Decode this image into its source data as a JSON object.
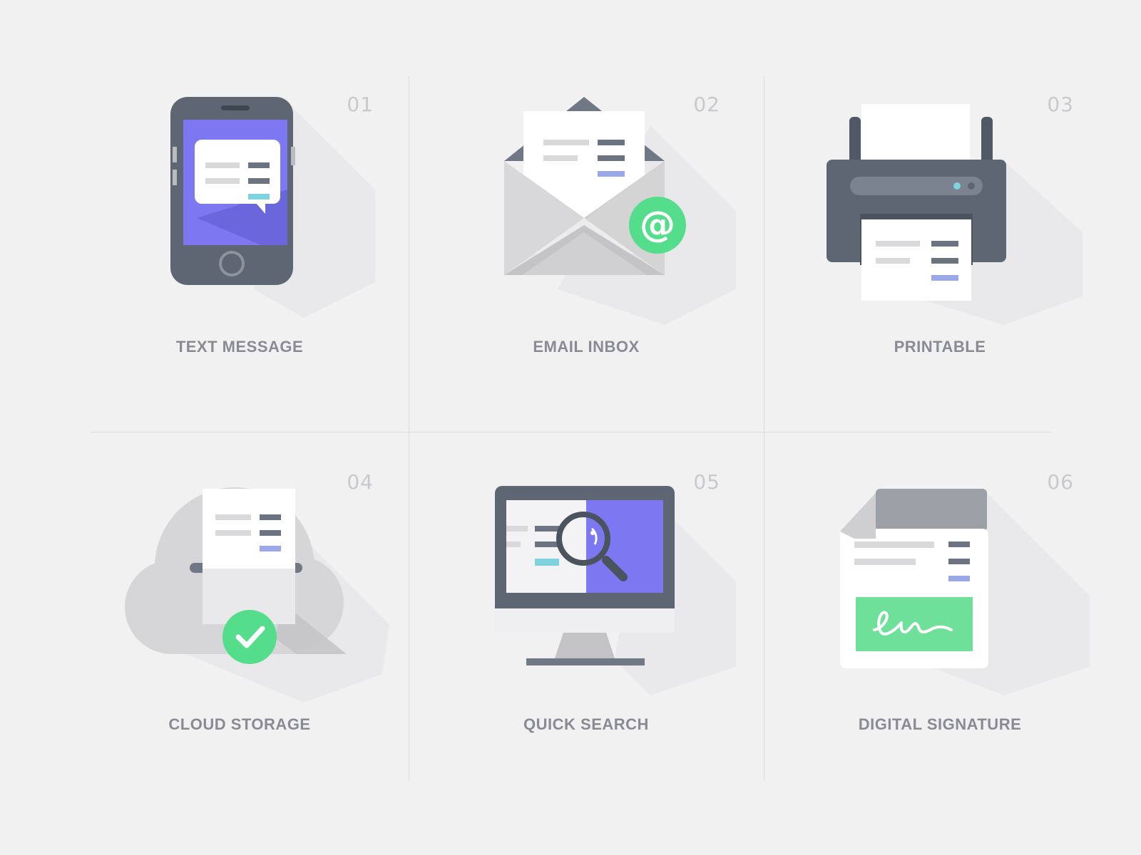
{
  "colors": {
    "background": "#f1f1f2",
    "dark_gray": "#5d6672",
    "purple": "#7b78f2",
    "green": "#54dd8b",
    "label": "#8a8b92",
    "number": "#c3c3c7"
  },
  "items": [
    {
      "number": "01",
      "label": "TEXT MESSAGE",
      "icon": "phone-message-icon"
    },
    {
      "number": "02",
      "label": "EMAIL INBOX",
      "icon": "email-envelope-icon"
    },
    {
      "number": "03",
      "label": "PRINTABLE",
      "icon": "printer-icon"
    },
    {
      "number": "04",
      "label": "CLOUD STORAGE",
      "icon": "cloud-storage-icon"
    },
    {
      "number": "05",
      "label": "QUICK SEARCH",
      "icon": "monitor-search-icon"
    },
    {
      "number": "06",
      "label": "DIGITAL SIGNATURE",
      "icon": "signature-document-icon"
    }
  ]
}
